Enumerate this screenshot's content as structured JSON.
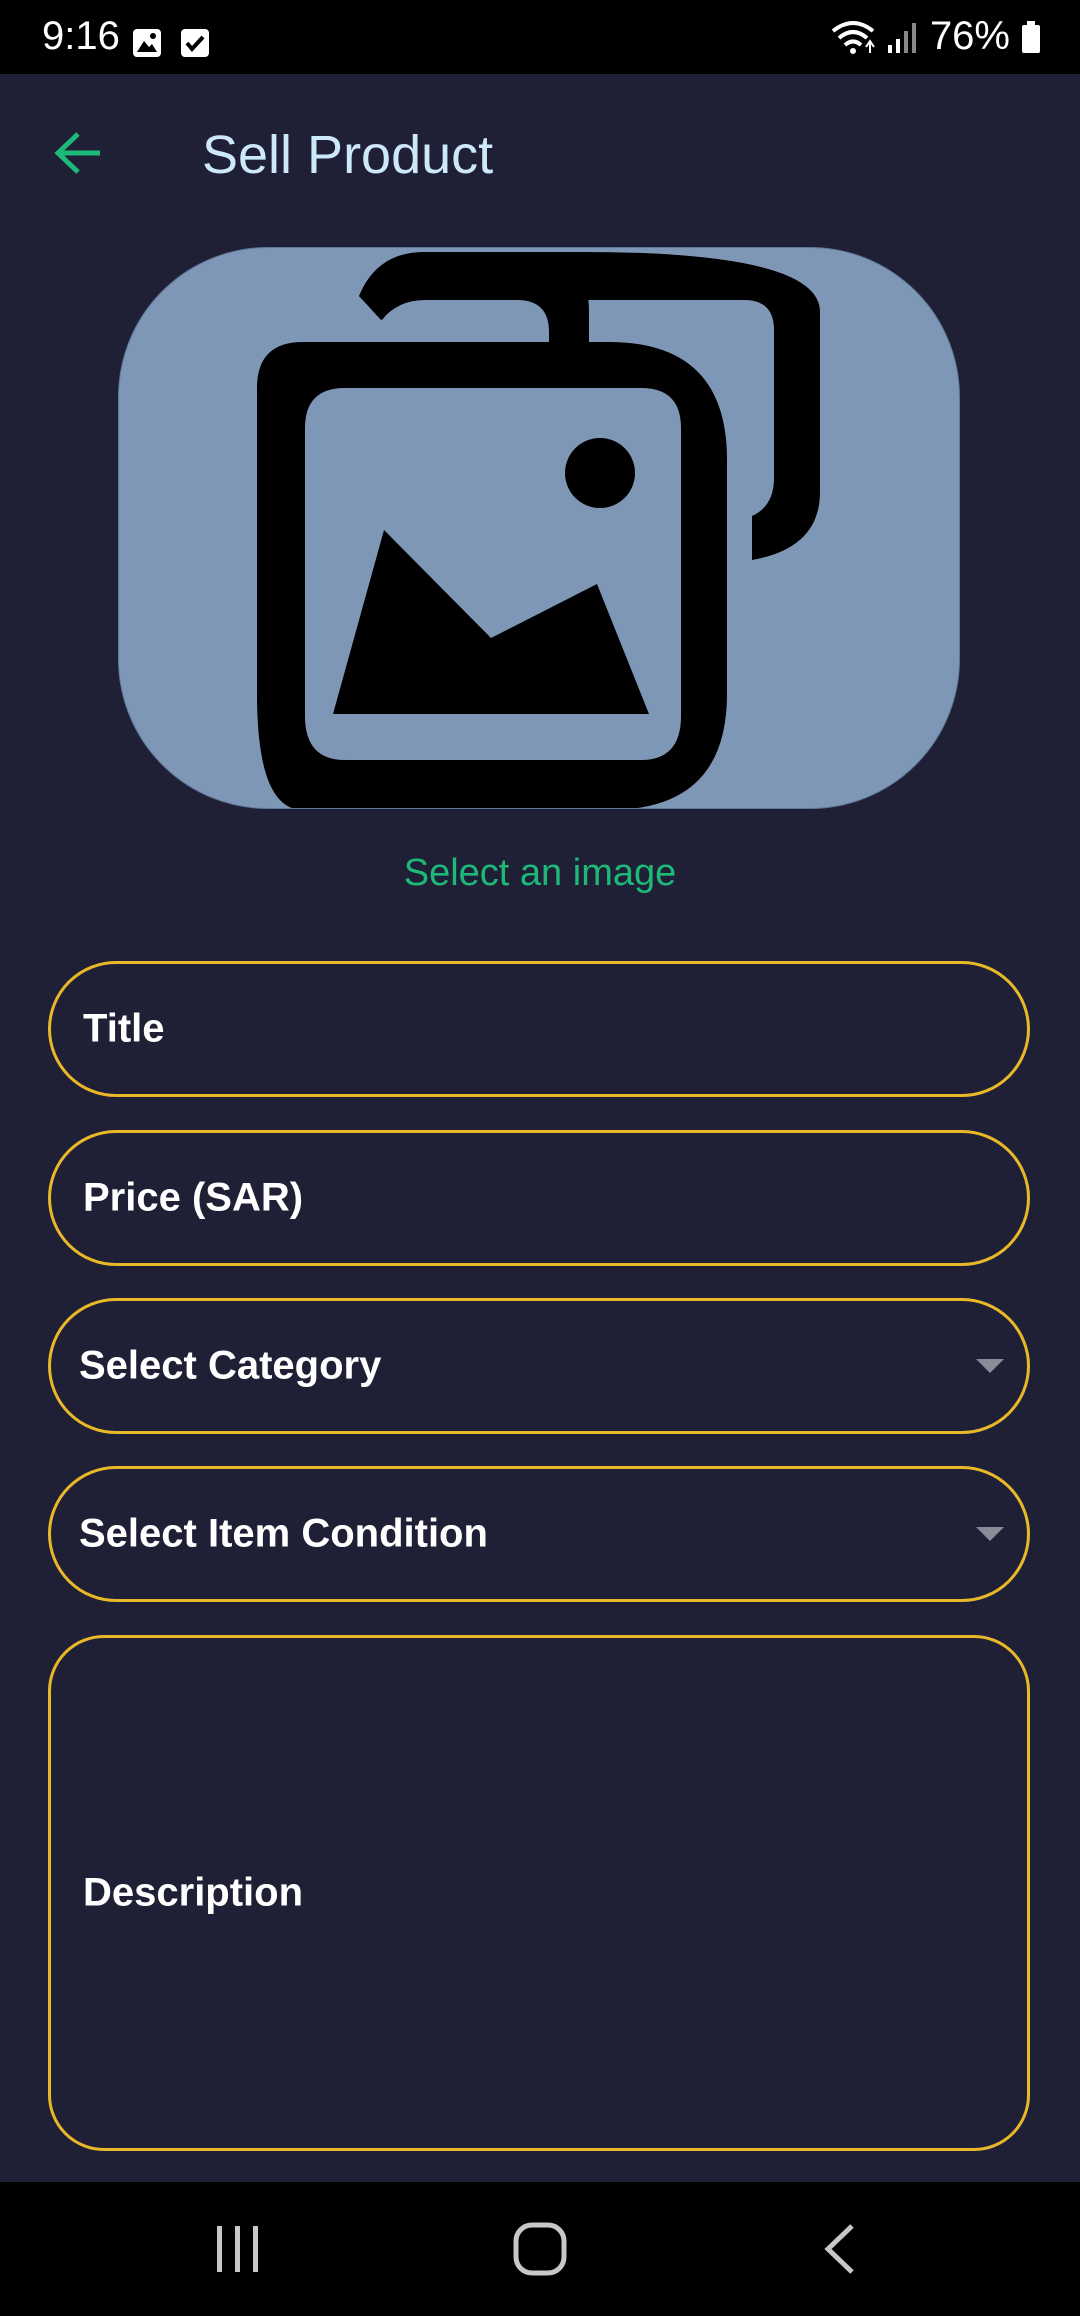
{
  "status_bar": {
    "time": "9:16",
    "notification_icons": [
      "image-icon",
      "checkbox-icon"
    ],
    "battery_percent": "76%"
  },
  "app_bar": {
    "title": "Sell Product",
    "back_icon": "arrow-left-icon"
  },
  "image_picker": {
    "icon": "image-gallery-icon",
    "link_text": "Select an image"
  },
  "form": {
    "title_label": "Title",
    "price_label": "Price (SAR)",
    "category_label": "Select Category",
    "condition_label": "Select Item Condition",
    "description_label": "Description"
  },
  "colors": {
    "background": "#1f1f36",
    "accent_green": "#1db978",
    "field_border": "#e8b829",
    "title_color": "#cde8f8",
    "picker_bg": "#7f97b6"
  },
  "nav_bar": {
    "recents_icon": "recents-icon",
    "home_icon": "home-icon",
    "back_icon": "back-icon"
  }
}
